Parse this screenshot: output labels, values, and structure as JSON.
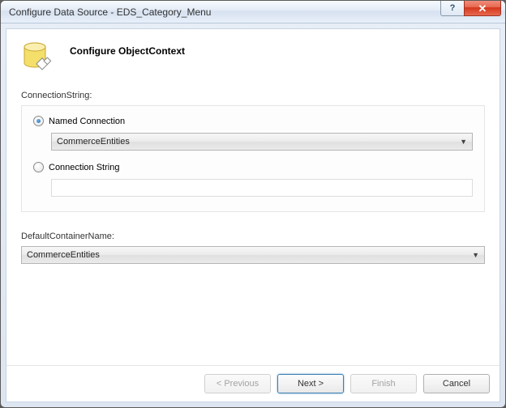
{
  "window": {
    "title": "Configure Data Source - EDS_Category_Menu",
    "help_symbol": "?"
  },
  "header": {
    "title": "Configure ObjectContext"
  },
  "connectionString": {
    "label": "ConnectionString:",
    "options": {
      "named": {
        "label": "Named Connection",
        "selected": true,
        "value": "CommerceEntities"
      },
      "raw": {
        "label": "Connection String",
        "selected": false,
        "value": ""
      }
    }
  },
  "defaultContainer": {
    "label": "DefaultContainerName:",
    "value": "CommerceEntities"
  },
  "footer": {
    "previous": "< Previous",
    "next": "Next >",
    "finish": "Finish",
    "cancel": "Cancel"
  }
}
